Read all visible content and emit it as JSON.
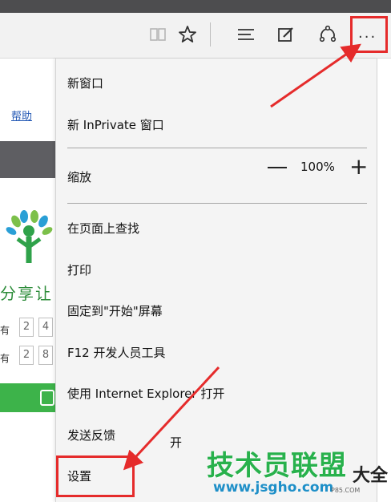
{
  "toolbar": {
    "icons": [
      "reading-view-icon",
      "favorite-star-icon",
      "hub-icon",
      "web-note-icon",
      "share-icon",
      "more-actions-icon"
    ],
    "more_label": "···"
  },
  "page": {
    "help_link": "帮助",
    "share_text": "分享让",
    "captcha_row1_label": "有",
    "captcha_row1_chars": [
      "2",
      "4"
    ],
    "captcha_row2_label": "有",
    "captcha_row2_chars": [
      "2",
      "8"
    ]
  },
  "menu": {
    "new_window": "新窗口",
    "new_inprivate": "新 InPrivate 窗口",
    "zoom_label": "缩放",
    "zoom_minus": "—",
    "zoom_value": "100%",
    "zoom_plus": "+",
    "find_on_page": "在页面上查找",
    "print": "打印",
    "pin_to_start": "固定到\"开始\"屏幕",
    "f12_tools": "F12 开发人员工具",
    "open_with_ie": "使用 Internet Explorer 打开",
    "send_feedback": "发送反馈",
    "settings": "设置"
  },
  "fragment": "开",
  "watermark": {
    "title": "技术员联盟",
    "url": "www.jsgho.com",
    "side": "大全",
    "sub": "P85.COM"
  },
  "colors": {
    "highlight_red": "#e52b2b",
    "watermark_green": "#28b14c",
    "watermark_blue": "#1e8fc8",
    "menu_bg": "#f4f4f4"
  }
}
